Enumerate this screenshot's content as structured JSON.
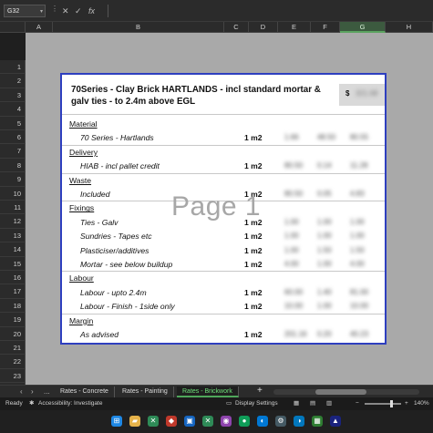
{
  "formula_bar": {
    "cell_ref": "G32",
    "fx": "fx",
    "cancel": "✕",
    "confirm": "✓",
    "value": ""
  },
  "columns": [
    "A",
    "B",
    "C",
    "D",
    "E",
    "F",
    "G",
    "H"
  ],
  "rows": [
    "1",
    "2",
    "3",
    "4",
    "5",
    "6",
    "7",
    "8",
    "9",
    "10",
    "11",
    "12",
    "13",
    "14",
    "15",
    "16",
    "17",
    "18",
    "19",
    "20",
    "21",
    "22",
    "23",
    "24"
  ],
  "page": {
    "title": "70Series - Clay Brick HARTLANDS - incl standard mortar & galv ties - to 2.4m above EGL",
    "currency": "$",
    "price": "321.68",
    "watermark": "Page 1",
    "lines": [
      {
        "type": "section",
        "label": "Material"
      },
      {
        "type": "item",
        "label": "70 Series - Hartlands",
        "qty": "1 m2",
        "a": "1.66",
        "b": "48.50",
        "c": "80.55"
      },
      {
        "type": "section",
        "label": "Delivery"
      },
      {
        "type": "item",
        "label": "HIAB - incl pallet credit",
        "qty": "1 m2",
        "a": "80.50",
        "b": "0.14",
        "c": "11.28"
      },
      {
        "type": "section",
        "label": "Waste"
      },
      {
        "type": "item",
        "label": "Included",
        "qty": "1 m2",
        "a": "80.50",
        "b": "0.05",
        "c": "4.83"
      },
      {
        "type": "section",
        "label": "Fixings"
      },
      {
        "type": "item",
        "label": "Ties - Galv",
        "qty": "1 m2",
        "a": "1.00",
        "b": "1.00",
        "c": "1.00"
      },
      {
        "type": "item",
        "label": "Sundries - Tapes etc",
        "qty": "1 m2",
        "a": "1.00",
        "b": "1.00",
        "c": "1.00"
      },
      {
        "type": "item",
        "label": "Plasticiser/additives",
        "qty": "1 m2",
        "a": "1.00",
        "b": "1.50",
        "c": "1.50"
      },
      {
        "type": "item",
        "label": "Mortar - see below buildup",
        "qty": "1 m2",
        "a": "4.00",
        "b": "1.00",
        "c": "4.00"
      },
      {
        "type": "section",
        "label": "Labour"
      },
      {
        "type": "item",
        "label": "Labour - upto 2.4m",
        "qty": "1 m2",
        "a": "60.00",
        "b": "1.40",
        "c": "81.00"
      },
      {
        "type": "item",
        "label": "Labour - Finish - 1side only",
        "qty": "1 m2",
        "a": "10.00",
        "b": "1.00",
        "c": "10.00"
      },
      {
        "type": "section",
        "label": "Margin"
      },
      {
        "type": "item",
        "label": "As advised",
        "qty": "1 m2",
        "a": "201.16",
        "b": "0.20",
        "c": "40.23"
      }
    ]
  },
  "tabs": {
    "more": "...",
    "items": [
      {
        "label": "Rates - Concrete",
        "active": false
      },
      {
        "label": "Rates - Painting",
        "active": false
      },
      {
        "label": "Rates - Brickwork",
        "active": true
      }
    ],
    "add": "+"
  },
  "status": {
    "ready": "Ready",
    "accessibility": "Accessibility: Investigate",
    "display_settings": "Display Settings",
    "zoom": "140%"
  },
  "colors": {
    "accent": "#4ea65a",
    "page_border": "#2e3fbf",
    "grid_bg": "#a9a9a9"
  }
}
